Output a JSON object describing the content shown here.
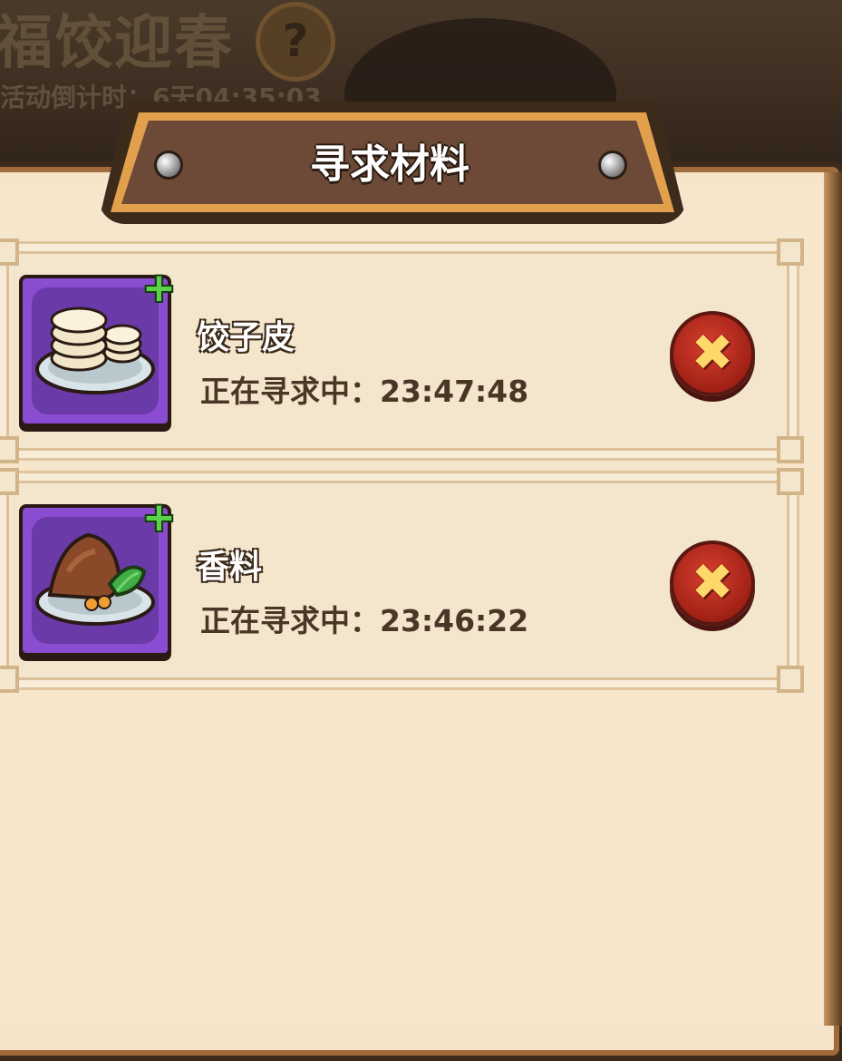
{
  "background": {
    "event_title": "福饺迎春",
    "help_symbol": "?",
    "countdown": "活动倒计时：6天04:35:03"
  },
  "panel": {
    "title": "寻求材料"
  },
  "materials": [
    {
      "name": "饺子皮",
      "status": "正在寻求中：23:47:48",
      "icon": "dumpling-wrapper-icon",
      "cancel_symbol": "✖"
    },
    {
      "name": "香料",
      "status": "正在寻求中：23:46:22",
      "icon": "spice-icon",
      "cancel_symbol": "✖"
    }
  ],
  "colors": {
    "panel_bg": "#f5e4c9",
    "icon_bg": "#8a4cd0",
    "cancel_red": "#c42a1e",
    "plus_green": "#5ad24a"
  }
}
